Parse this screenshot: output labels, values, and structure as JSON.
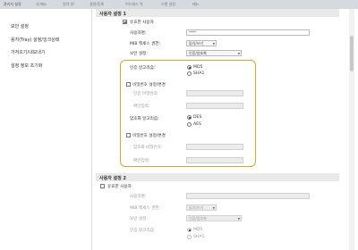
{
  "topbar": {
    "title": "관리자 설정",
    "menu": [
      "내 메뉴",
      "원격 UI",
      "설정/등록",
      "어드레스 북",
      "스캔 설정",
      "메뉴"
    ]
  },
  "sidebar": {
    "items": [
      {
        "label": "보안 설정"
      },
      {
        "label": "용지(Tray) 설정/잉크상태"
      },
      {
        "label": "가져오기/내보내기"
      },
      {
        "label": "설정 정보 초기화"
      }
    ]
  },
  "section1": {
    "header": "사용자 설정 1",
    "use_user_label": "유효한 사용자",
    "user_name_label": "사용자명:",
    "user_name_value": "****",
    "mib_label": "MIB 액세스 권한:",
    "mib_value": "읽기/쓰기",
    "security_label": "보안 설정:",
    "security_value": "인증/암호화",
    "auth_algo_label": "인증 알고리즘:",
    "auth_algo_options": [
      "MD5",
      "SHA1"
    ],
    "auth_pw_toggle_label": "비밀번호 설정/변경",
    "auth_pw_label": "인증 비밀번호:",
    "auth_pw_confirm_label": "확인입력:",
    "enc_algo_label": "암호화 알고리즘:",
    "enc_algo_options": [
      "DES",
      "AES"
    ],
    "enc_pw_toggle_label": "비밀번호 설정/변경",
    "enc_pw_label": "암호화 비밀번호:",
    "enc_pw_confirm_label": "확인입력:"
  },
  "section2": {
    "header": "사용자 설정 2",
    "use_user_label": "유효한 사용자",
    "user_name_label": "사용자명:",
    "mib_label": "MIB 액세스 권한:",
    "mib_value": "읽기/쓰기",
    "security_label": "보안 설정:",
    "security_value": "인증/암호화",
    "auth_algo_label": "인증 알고리즘:",
    "auth_algo_options": [
      "MD5",
      "SHA1"
    ]
  },
  "colors": {
    "highlight": "#f0a020",
    "section_header_bg": "#e9e9e9",
    "topbar_bg": "#d6d9dd"
  }
}
